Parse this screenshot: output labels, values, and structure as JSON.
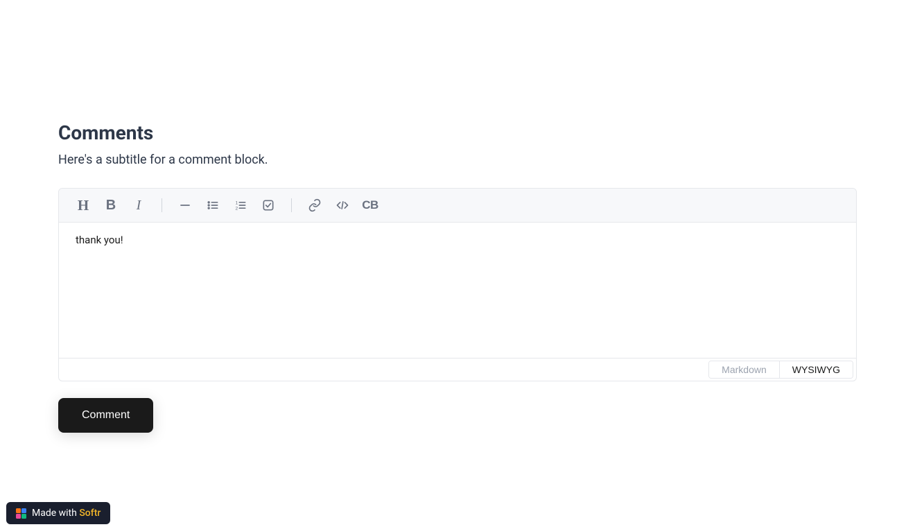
{
  "header": {
    "title": "Comments",
    "subtitle": "Here's a subtitle for a comment block."
  },
  "toolbar": {
    "heading": "H",
    "bold": "B",
    "italic": "I",
    "codeblock": "CB"
  },
  "editor": {
    "content": "thank you!"
  },
  "modes": {
    "markdown": "Markdown",
    "wysiwyg": "WYSIWYG",
    "active": "wysiwyg"
  },
  "actions": {
    "submit": "Comment"
  },
  "badge": {
    "prefix": "Made with ",
    "brand": "Softr",
    "colors": {
      "orange": "#f97316",
      "blue": "#3b82f6",
      "pink": "#ec4899",
      "green": "#10b981"
    }
  }
}
